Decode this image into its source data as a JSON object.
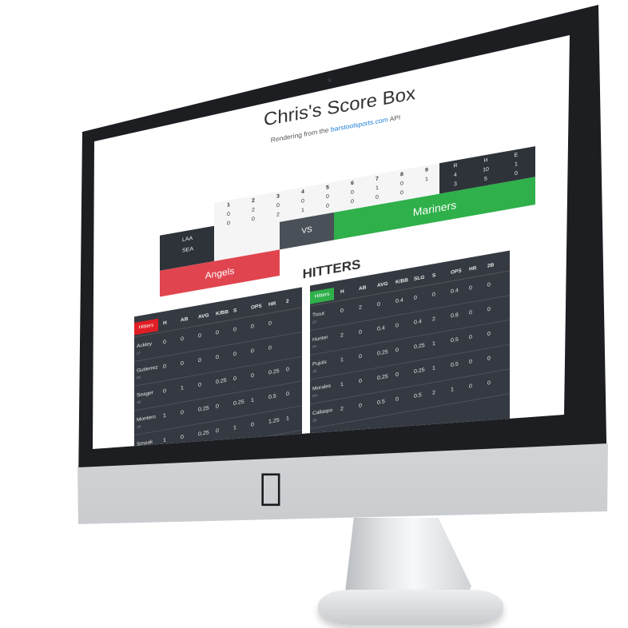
{
  "page": {
    "title": "Chris's Score Box",
    "subtitle_prefix": "Rendering from the ",
    "subtitle_link": "barstoolsports.com",
    "subtitle_suffix": " API"
  },
  "scorebox": {
    "away_abbr": "LAA",
    "home_abbr": "SEA",
    "innings": [
      {
        "label": "1",
        "away": "0",
        "home": "0"
      },
      {
        "label": "2",
        "away": "2",
        "home": "0"
      },
      {
        "label": "3",
        "away": "0",
        "home": "2"
      },
      {
        "label": "4",
        "away": "0",
        "home": "1"
      },
      {
        "label": "5",
        "away": "0",
        "home": "0"
      },
      {
        "label": "6",
        "away": "0",
        "home": "0"
      },
      {
        "label": "7",
        "away": "1",
        "home": "0"
      },
      {
        "label": "8",
        "away": "0",
        "home": "0"
      },
      {
        "label": "9",
        "away": "1",
        "home": ""
      }
    ],
    "rhe_labels": [
      "R",
      "H",
      "E"
    ],
    "away_rhe": [
      "4",
      "10",
      "1"
    ],
    "home_rhe": [
      "3",
      "5",
      "0"
    ],
    "vs_label": "VS",
    "away_team": "Angels",
    "home_team": "Mariners",
    "colors": {
      "away": "#e0454f",
      "home": "#2fb04a",
      "dark": "#2e333a"
    }
  },
  "section_title": "HITTERS",
  "left_table": {
    "tag": "Hitters",
    "tag_color": "#e01e25",
    "columns": [
      "H",
      "AB",
      "AVG",
      "K/BB",
      "S",
      "OPS",
      "HR",
      "2"
    ],
    "rows": [
      {
        "name": "Ackley",
        "pos": "LF",
        "cells": [
          "0",
          "0",
          "0",
          "0",
          "0",
          "0",
          "0",
          ""
        ]
      },
      {
        "name": "Gutierrez",
        "pos": "RF",
        "cells": [
          "0",
          "0",
          "0",
          "0",
          "0",
          "0",
          "0",
          ""
        ]
      },
      {
        "name": "Seager",
        "pos": "3B",
        "cells": [
          "0",
          "1",
          "0",
          "0.25",
          "0",
          "0",
          "0.25",
          "0"
        ]
      },
      {
        "name": "Montero",
        "pos": "1B",
        "cells": [
          "1",
          "0",
          "0.25",
          "0",
          "0.25",
          "1",
          "0.5",
          "0"
        ]
      },
      {
        "name": "Smoak",
        "pos": "1B",
        "cells": [
          "1",
          "0",
          "0.25",
          "0",
          "1",
          "0",
          "1.25",
          "1"
        ]
      }
    ]
  },
  "right_table": {
    "tag": "Hitters",
    "tag_color": "#2fb04a",
    "columns": [
      "H",
      "AB",
      "AVG",
      "K/BB",
      "SLG",
      "S",
      "OPS",
      "HR",
      "2B"
    ],
    "rows": [
      {
        "name": "Trout",
        "pos": "CF",
        "cells": [
          "0",
          "2",
          "0",
          "0.4",
          "0",
          "0",
          "0.4",
          "0",
          "0"
        ]
      },
      {
        "name": "Hunter",
        "pos": "RF",
        "cells": [
          "2",
          "0",
          "0.4",
          "0",
          "0.4",
          "2",
          "0.8",
          "0",
          "0"
        ]
      },
      {
        "name": "Pujols",
        "pos": "1B",
        "cells": [
          "1",
          "0",
          "0.25",
          "0",
          "0.25",
          "1",
          "0.5",
          "0",
          "0"
        ]
      },
      {
        "name": "Morales",
        "pos": "DH",
        "cells": [
          "1",
          "0",
          "0.25",
          "0",
          "0.25",
          "1",
          "0.5",
          "0",
          "0"
        ]
      },
      {
        "name": "Callaspo",
        "pos": "3B",
        "cells": [
          "2",
          "0",
          "0.5",
          "0",
          "0.5",
          "2",
          "1",
          "0",
          "0"
        ]
      }
    ]
  },
  "hardware": {
    "logo": ""
  }
}
